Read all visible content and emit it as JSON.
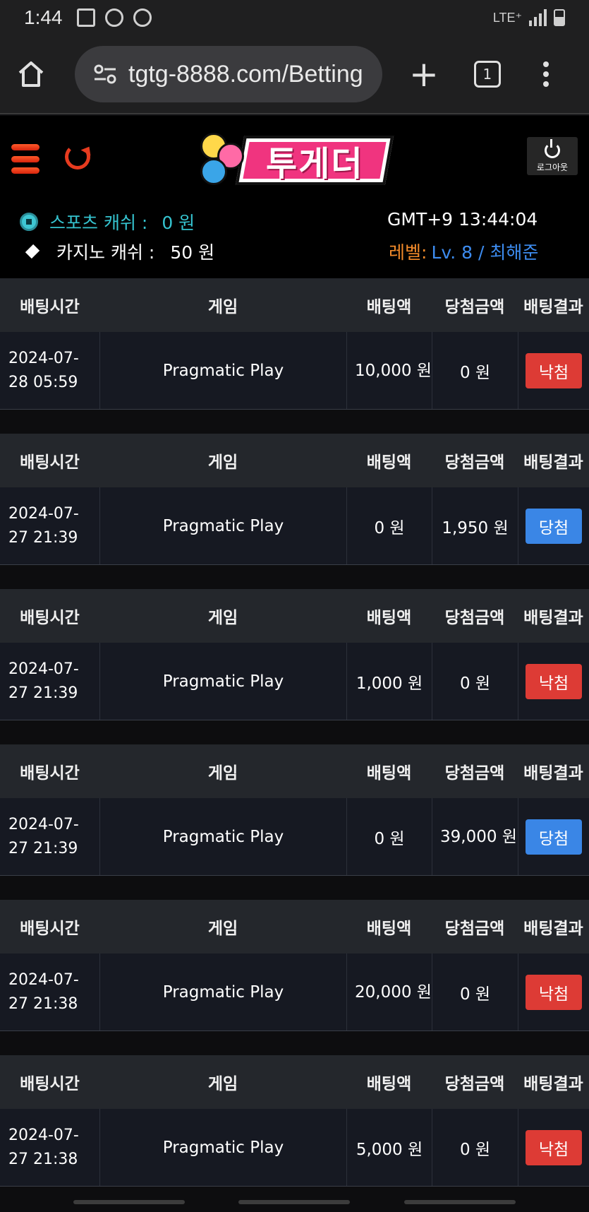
{
  "statusbar": {
    "time": "1:44",
    "network": "LTE⁺"
  },
  "browser": {
    "url": "tgtg-8888.com/Betting",
    "tab_count": "1"
  },
  "site": {
    "logo_text": "투게더",
    "logout_label": "로그아웃",
    "sports_cash_label": "스포츠 캐쉬 :",
    "sports_cash_value": "0 원",
    "casino_cash_label": "카지노 캐쉬 :",
    "casino_cash_value": "50 원",
    "clock": "GMT+9 13:44:04",
    "level_label": "레벨:",
    "level_value": "Lv. 8 / 최해준"
  },
  "table_headers": [
    "배팅시간",
    "게임",
    "배팅액",
    "당첨금액",
    "배팅결과"
  ],
  "bets": [
    {
      "time_line1": "2024-07-",
      "time_line2": "28 05:59",
      "game": "Pragmatic Play",
      "bet": "10,000 원",
      "win": "0 원",
      "result": "낙첨",
      "status": "lose"
    },
    {
      "time_line1": "2024-07-",
      "time_line2": "27 21:39",
      "game": "Pragmatic Play",
      "bet": "0 원",
      "win": "1,950 원",
      "result": "당첨",
      "status": "win"
    },
    {
      "time_line1": "2024-07-",
      "time_line2": "27 21:39",
      "game": "Pragmatic Play",
      "bet": "1,000 원",
      "win": "0 원",
      "result": "낙첨",
      "status": "lose"
    },
    {
      "time_line1": "2024-07-",
      "time_line2": "27 21:39",
      "game": "Pragmatic Play",
      "bet": "0 원",
      "win": "39,000 원",
      "result": "당첨",
      "status": "win"
    },
    {
      "time_line1": "2024-07-",
      "time_line2": "27 21:38",
      "game": "Pragmatic Play",
      "bet": "20,000 원",
      "win": "0 원",
      "result": "낙첨",
      "status": "lose"
    },
    {
      "time_line1": "2024-07-",
      "time_line2": "27 21:38",
      "game": "Pragmatic Play",
      "bet": "5,000 원",
      "win": "0 원",
      "result": "낙첨",
      "status": "lose"
    }
  ],
  "colors": {
    "lose": "#dd3b35",
    "win": "#3a86e6",
    "accent_teal": "#35c3cf",
    "accent_orange": "#f28a2a",
    "accent_blue": "#3d8cf0"
  },
  "icons": [
    "home-icon",
    "site-settings-icon",
    "new-tab-icon",
    "tab-switcher-icon",
    "overflow-menu-icon",
    "hamburger-menu-icon",
    "refresh-icon",
    "power-icon",
    "soccer-ball-icon",
    "diamond-icon"
  ]
}
